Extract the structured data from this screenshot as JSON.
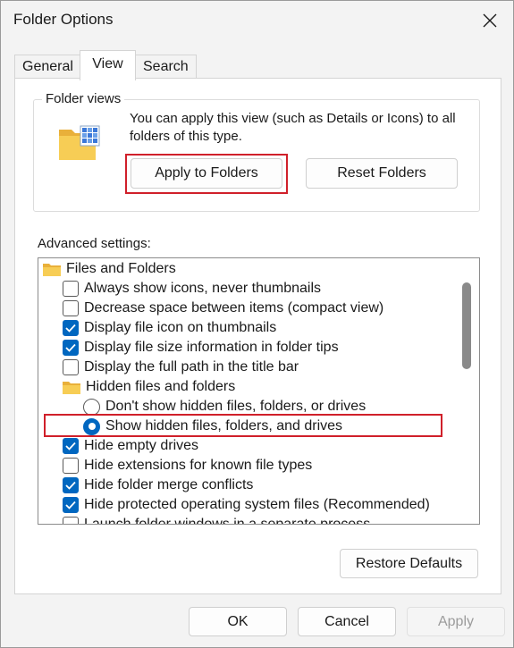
{
  "window": {
    "title": "Folder Options",
    "close_icon": "close-icon"
  },
  "tabs": [
    {
      "label": "General",
      "active": false
    },
    {
      "label": "View",
      "active": true
    },
    {
      "label": "Search",
      "active": false
    }
  ],
  "folder_views": {
    "group_label": "Folder views",
    "icon": "folder-views-icon",
    "description": "You can apply this view (such as Details or Icons) to all folders of this type.",
    "apply_button": "Apply to Folders",
    "reset_button": "Reset Folders"
  },
  "advanced": {
    "label": "Advanced settings:",
    "items": [
      {
        "type": "folder",
        "label": "Files and Folders"
      },
      {
        "type": "checkbox",
        "label": "Always show icons, never thumbnails",
        "checked": false
      },
      {
        "type": "checkbox",
        "label": "Decrease space between items (compact view)",
        "checked": false
      },
      {
        "type": "checkbox",
        "label": "Display file icon on thumbnails",
        "checked": true
      },
      {
        "type": "checkbox",
        "label": "Display file size information in folder tips",
        "checked": true
      },
      {
        "type": "checkbox",
        "label": "Display the full path in the title bar",
        "checked": false
      },
      {
        "type": "folder",
        "label": "Hidden files and folders"
      },
      {
        "type": "radio",
        "label": "Don't show hidden files, folders, or drives",
        "selected": false
      },
      {
        "type": "radio",
        "label": "Show hidden files, folders, and drives",
        "selected": true
      },
      {
        "type": "checkbox",
        "label": "Hide empty drives",
        "checked": true
      },
      {
        "type": "checkbox",
        "label": "Hide extensions for known file types",
        "checked": false
      },
      {
        "type": "checkbox",
        "label": "Hide folder merge conflicts",
        "checked": true
      },
      {
        "type": "checkbox",
        "label": "Hide protected operating system files (Recommended)",
        "checked": true
      },
      {
        "type": "checkbox",
        "label": "Launch folder windows in a separate process",
        "checked": false
      }
    ],
    "restore_button": "Restore Defaults"
  },
  "footer": {
    "ok": "OK",
    "cancel": "Cancel",
    "apply": "Apply"
  },
  "colors": {
    "accent": "#0067c0",
    "highlight": "#d0202a",
    "folder": "#f5c542"
  }
}
